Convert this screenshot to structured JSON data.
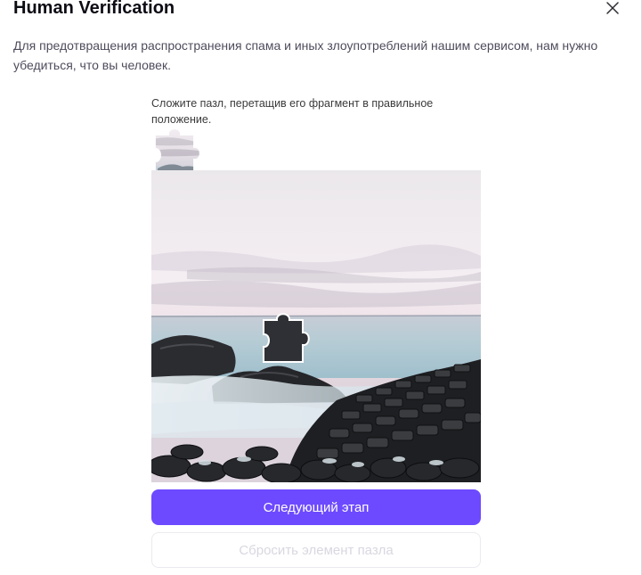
{
  "dialog": {
    "title": "Human Verification",
    "description": "Для предотвращения распространения спама и иных злоупотреблений нашим сервисом, нам нужно убедиться, что вы человек.",
    "close_icon": "close-icon"
  },
  "captcha": {
    "instruction": "Сложите пазл, перетащив его фрагмент в правильное положение.",
    "piece_icon": "puzzle-piece",
    "next_button": "Следующий этап",
    "reset_button": "Сбросить элемент пазла",
    "colors": {
      "accent": "#6d4aff",
      "disabled_text": "#d9d7e0"
    }
  }
}
